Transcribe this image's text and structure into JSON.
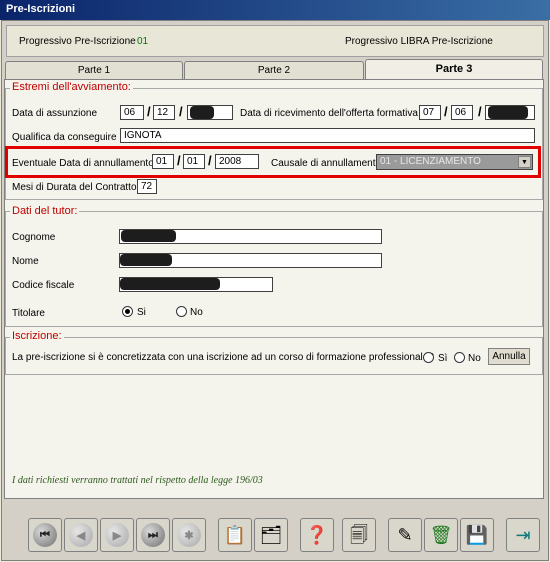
{
  "window": {
    "title": "Pre-Iscrizioni"
  },
  "info": {
    "progressivo_label": "Progressivo Pre-Iscrizione",
    "progressivo_value": "01",
    "libra_label": "Progressivo LIBRA Pre-Iscrizione"
  },
  "tabs": [
    {
      "label": "Parte 1"
    },
    {
      "label": "Parte 2"
    },
    {
      "label": "Parte 3",
      "active": true
    }
  ],
  "avviamento": {
    "legend": "Estremi dell'avviamento:",
    "data_assunzione_label": "Data di assunzione",
    "data_assunzione_day": "06",
    "data_assunzione_month": "12",
    "data_ricevimento_label": "Data di ricevimento dell'offerta formativa",
    "data_ricevimento_day": "07",
    "data_ricevimento_month": "06",
    "qualifica_label": "Qualifica da conseguire",
    "qualifica_value": "IGNOTA",
    "annullamento_label": "Eventuale Data di annullamento",
    "annullamento_day": "01",
    "annullamento_month": "01",
    "annullamento_year": "2008",
    "causale_label": "Causale di annullamento",
    "causale_value": "01 - LICENZIAMENTO",
    "mesi_label": "Mesi di Durata del Contratto",
    "mesi_value": "72"
  },
  "tutor": {
    "legend": "Dati del tutor:",
    "cognome_label": "Cognome",
    "nome_label": "Nome",
    "codice_fiscale_label": "Codice fiscale",
    "titolare_label": "Titolare",
    "si_label": "Si",
    "no_label": "No"
  },
  "iscrizione": {
    "legend": "Iscrizione:",
    "question": "La pre-iscrizione si è concretizzata con una iscrizione ad un corso di formazione professionale?",
    "si_label": "Sì",
    "no_label": "No",
    "annulla_label": "Annulla"
  },
  "footer_note": "I dati richiesti verranno trattati nel rispetto della legge 196/03",
  "toolbar_icons": [
    "first-icon",
    "prev-icon",
    "next-icon",
    "last-icon",
    "new-icon",
    "report-icon",
    "archive-icon",
    "help-icon",
    "documents-icon",
    "edit-icon",
    "delete-icon",
    "save-icon",
    "exit-icon"
  ],
  "colors": {
    "legend": "#c00000",
    "highlight_border": "#e00000",
    "title_bar": "#0a246a"
  }
}
